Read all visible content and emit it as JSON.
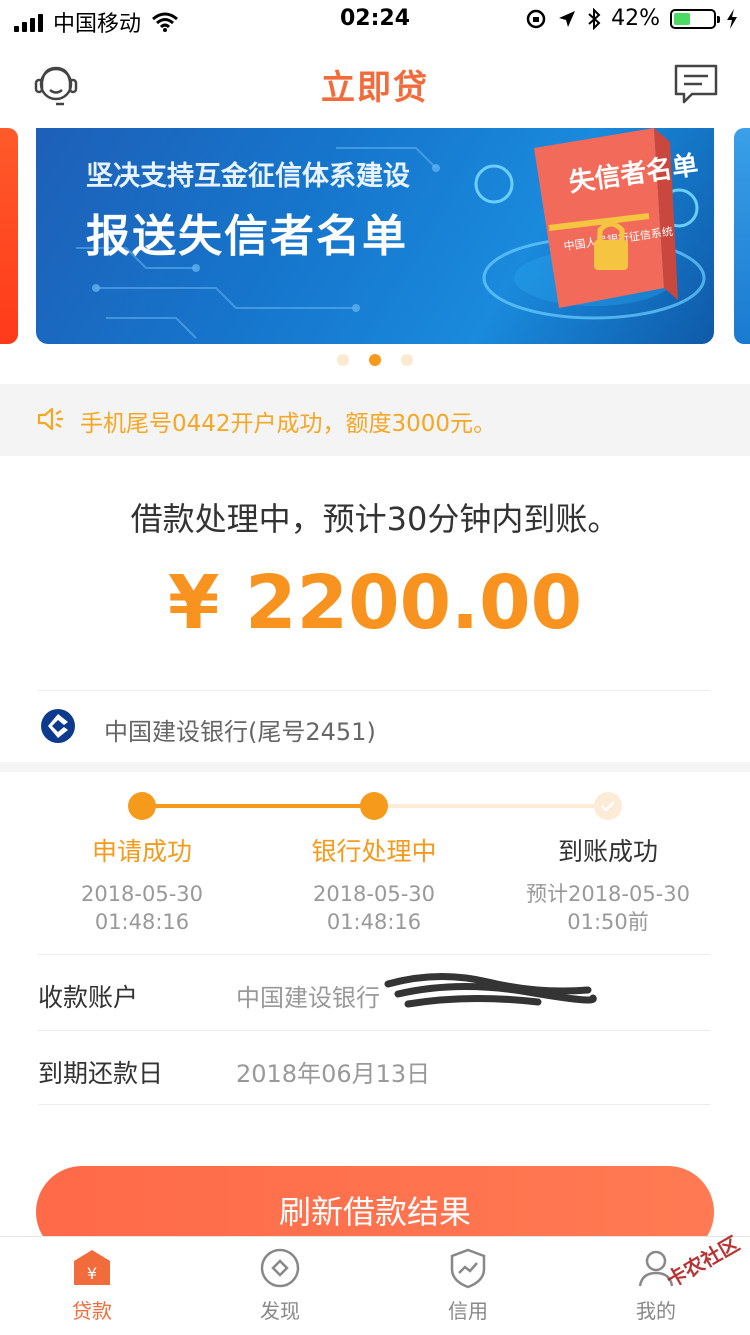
{
  "status_bar": {
    "carrier": "中国移动",
    "time": "02:24",
    "battery": "42%",
    "battery_level": 0.42
  },
  "nav": {
    "title": "立即贷",
    "left_icon": "customer-service-icon",
    "right_icon": "message-icon"
  },
  "banner": {
    "subtitle": "坚决支持互金征信体系建设",
    "title": "报送失信者名单",
    "book_title": "失信者名单",
    "book_caption": "中国人民银行征信系统",
    "active_index": 1,
    "count": 3
  },
  "notice": {
    "icon": "speaker-icon",
    "text": "手机尾号0442开户成功，额度3000元。"
  },
  "loan": {
    "status_text": "借款处理中，预计30分钟内到账。",
    "amount": "¥ 2200.00",
    "bank_name": "中国建设银行(尾号2451)"
  },
  "progress": {
    "steps": [
      {
        "label": "申请成功",
        "date": "2018-05-30",
        "time": "01:48:16",
        "state": "done"
      },
      {
        "label": "银行处理中",
        "date": "2018-05-30",
        "time": "01:48:16",
        "state": "done"
      },
      {
        "label": "到账成功",
        "date": "预计2018-05-30",
        "time": "01:50前",
        "state": "pending"
      }
    ]
  },
  "details": {
    "account_label": "收款账户",
    "account_value": "中国建设银行",
    "due_label": "到期还款日",
    "due_value": "2018年06月13日"
  },
  "actions": {
    "refresh_label": "刷新借款结果"
  },
  "tabbar": {
    "items": [
      {
        "label": "贷款",
        "icon": "loan-icon",
        "active": true
      },
      {
        "label": "发现",
        "icon": "discover-icon",
        "active": false
      },
      {
        "label": "信用",
        "icon": "credit-icon",
        "active": false
      },
      {
        "label": "我的",
        "icon": "profile-icon",
        "active": false
      }
    ]
  },
  "watermark": "卡农社区",
  "colors": {
    "brand": "#f26b3a",
    "accent": "#f59a1b",
    "button": "#ff6a48"
  }
}
